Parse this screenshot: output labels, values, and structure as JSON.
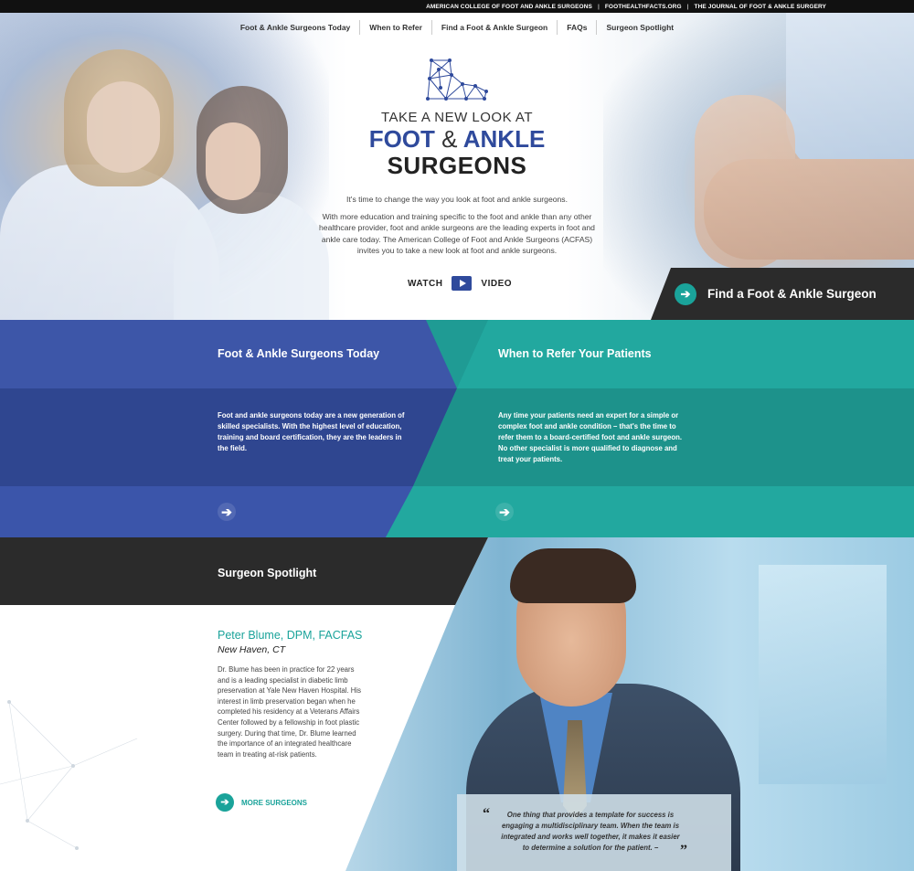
{
  "topbar": {
    "links": [
      "AMERICAN COLLEGE OF FOOT AND ANKLE SURGEONS",
      "FOOTHEALTHFACTS.ORG",
      "THE JOURNAL OF FOOT & ANKLE SURGERY"
    ]
  },
  "nav": {
    "items": [
      "Foot & Ankle Surgeons Today",
      "When to Refer",
      "Find a Foot & Ankle Surgeon",
      "FAQs",
      "Surgeon Spotlight"
    ]
  },
  "hero": {
    "line1": "TAKE A NEW LOOK AT",
    "line2a": "FOOT",
    "amp": "&",
    "line2b": "ANKLE",
    "line3": "SURGEONS",
    "para1": "It's time to change the way you look at foot and ankle surgeons.",
    "para2": "With more education and training specific to the foot and ankle than any other healthcare provider, foot and ankle surgeons are the leading experts in foot and ankle care today. The American College of Foot and Ankle Surgeons (ACFAS) invites you to take a new look at foot and ankle surgeons.",
    "watch": "WATCH",
    "video": "VIDEO",
    "find_button": "Find a Foot & Ankle Surgeon"
  },
  "panels": {
    "left": {
      "title": "Foot & Ankle Surgeons Today",
      "body": "Foot and ankle surgeons today are a new generation of skilled specialists. With the highest level of education, training and board certification, they are the leaders in the field."
    },
    "right": {
      "title": "When to Refer Your Patients",
      "body": "Any time your patients need an expert for a simple or complex foot and ankle condition – that's the time to refer them to a board-certified foot and ankle surgeon. No other specialist is more qualified to diagnose and treat your patients."
    }
  },
  "spotlight": {
    "title": "Surgeon Spotlight",
    "name": "Peter Blume, DPM, FACFAS",
    "location": "New Haven, CT",
    "bio": "Dr. Blume has been in practice for 22 years and is a leading specialist in diabetic limb preservation at Yale New Haven Hospital. His interest in limb preservation began when he completed his residency at a Veterans Affairs Center followed by a fellowship in foot plastic surgery. During that time, Dr. Blume learned the importance of an integrated healthcare team in treating at-risk patients.",
    "more": "MORE SURGEONS",
    "quote": "One thing that provides a template for success is engaging a multidisciplinary team. When the team is integrated and works well together, it makes it easier to determine a solution for the patient. –"
  },
  "colors": {
    "brand_blue": "#3d56a8",
    "brand_teal": "#22a89f",
    "dark": "#2b2b2b"
  }
}
